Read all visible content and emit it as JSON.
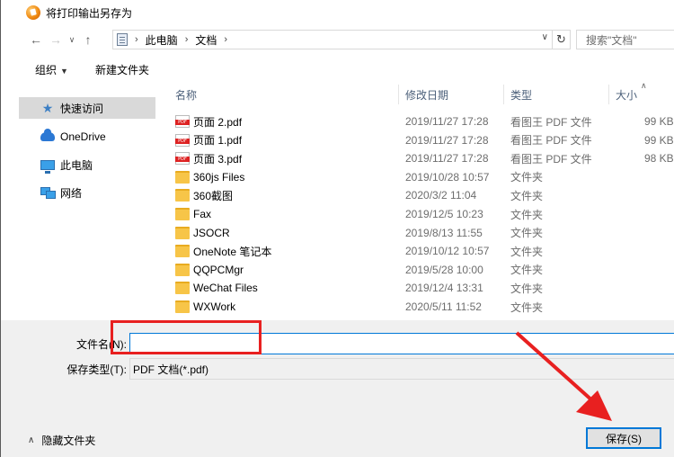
{
  "window": {
    "title": "将打印输出另存为"
  },
  "address": {
    "breadcrumb": [
      "此电脑",
      "文档"
    ],
    "search_placeholder": "搜索\"文档\""
  },
  "toolbar": {
    "organize_label": "组织",
    "new_folder_label": "新建文件夹"
  },
  "nav": {
    "items": [
      {
        "label": "快速访问",
        "icon": "star-icon",
        "selected": true
      },
      {
        "label": "OneDrive",
        "icon": "cloud-icon",
        "selected": false
      },
      {
        "label": "此电脑",
        "icon": "computer-icon",
        "selected": false
      },
      {
        "label": "网络",
        "icon": "network-icon",
        "selected": false
      }
    ]
  },
  "columns": {
    "name": "名称",
    "date": "修改日期",
    "type": "类型",
    "size": "大小"
  },
  "files": [
    {
      "name": "页面 2.pdf",
      "date": "2019/11/27 17:28",
      "type": "看图王 PDF 文件",
      "size": "99 KB",
      "kind": "pdf"
    },
    {
      "name": "页面 1.pdf",
      "date": "2019/11/27 17:28",
      "type": "看图王 PDF 文件",
      "size": "99 KB",
      "kind": "pdf"
    },
    {
      "name": "页面 3.pdf",
      "date": "2019/11/27 17:28",
      "type": "看图王 PDF 文件",
      "size": "98 KB",
      "kind": "pdf"
    },
    {
      "name": "360js Files",
      "date": "2019/10/28 10:57",
      "type": "文件夹",
      "size": "",
      "kind": "folder"
    },
    {
      "name": "360截图",
      "date": "2020/3/2 11:04",
      "type": "文件夹",
      "size": "",
      "kind": "folder"
    },
    {
      "name": "Fax",
      "date": "2019/12/5 10:23",
      "type": "文件夹",
      "size": "",
      "kind": "folder"
    },
    {
      "name": "JSOCR",
      "date": "2019/8/13 11:55",
      "type": "文件夹",
      "size": "",
      "kind": "folder"
    },
    {
      "name": "OneNote 笔记本",
      "date": "2019/10/12 10:57",
      "type": "文件夹",
      "size": "",
      "kind": "folder"
    },
    {
      "name": "QQPCMgr",
      "date": "2019/5/28 10:00",
      "type": "文件夹",
      "size": "",
      "kind": "folder"
    },
    {
      "name": "WeChat Files",
      "date": "2019/12/4 13:31",
      "type": "文件夹",
      "size": "",
      "kind": "folder"
    },
    {
      "name": "WXWork",
      "date": "2020/5/11 11:52",
      "type": "文件夹",
      "size": "",
      "kind": "folder"
    }
  ],
  "form": {
    "filename_label": "文件名(N):",
    "filename_value": "",
    "filetype_label": "保存类型(T):",
    "filetype_value": "PDF 文档(*.pdf)"
  },
  "footer": {
    "hide_folders_label": "隐藏文件夹",
    "save_label": "保存(S)"
  },
  "colors": {
    "annotation": "#e82020",
    "accent": "#0078d7"
  }
}
